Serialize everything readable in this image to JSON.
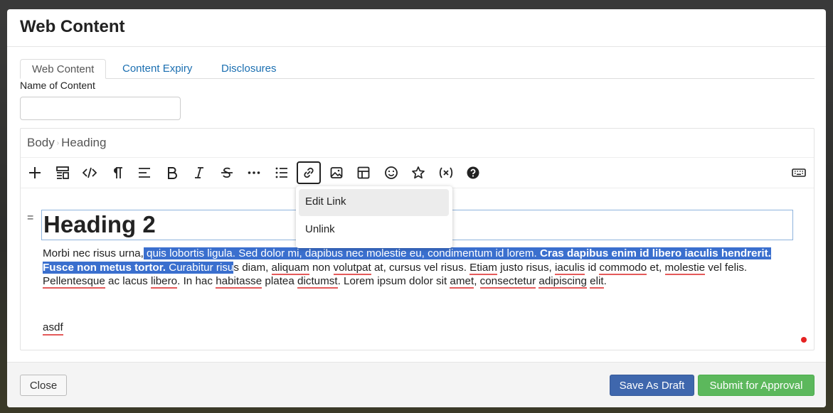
{
  "modal": {
    "title": "Web Content"
  },
  "tabs": [
    {
      "label": "Web Content",
      "active": true
    },
    {
      "label": "Content Expiry",
      "active": false
    },
    {
      "label": "Disclosures",
      "active": false
    }
  ],
  "name_field": {
    "label": "Name of Content",
    "value": "",
    "placeholder": ""
  },
  "editor": {
    "breadcrumb": [
      "Body",
      "Heading"
    ],
    "toolbar": [
      {
        "icon": "plus-icon"
      },
      {
        "icon": "blocks-icon"
      },
      {
        "icon": "code-icon"
      },
      {
        "icon": "paragraph-icon"
      },
      {
        "icon": "align-left-icon"
      },
      {
        "icon": "bold-icon"
      },
      {
        "icon": "italic-icon"
      },
      {
        "icon": "strikethrough-icon"
      },
      {
        "icon": "more-icon"
      },
      {
        "icon": "list-icon"
      },
      {
        "icon": "link-icon",
        "active": true
      },
      {
        "icon": "image-icon"
      },
      {
        "icon": "table-icon"
      },
      {
        "icon": "emoji-icon"
      },
      {
        "icon": "star-icon"
      },
      {
        "icon": "variable-icon"
      },
      {
        "icon": "help-icon"
      },
      {
        "icon": "keyboard-icon"
      }
    ],
    "block_handle": "=",
    "heading": "Heading 2",
    "paragraph": {
      "t1": "Morbi nec risus urna,",
      "s1": " quis lobortis ligula. Sed dolor mi, dapibus nec molestie eu, condimentum id lorem. ",
      "s2": "Cras dapibus enim id libero iaculis hendrerit. Fusce non metus tortor.",
      "s3": " Curabitur risu",
      "t2": "s diam, ",
      "w_aliquam": "aliquam",
      "t3": " non ",
      "w_volutpat": "volutpat",
      "t4": " at, cursus vel risus. ",
      "w_etiam": "Etiam",
      "t5": " justo risus, ",
      "w_iaculis": "iaculis",
      "t6": " id ",
      "w_commodo": "commodo",
      "t7": " et, ",
      "w_molestie": "molestie",
      "t8": " vel felis. ",
      "w_pellentesque": "Pellentesque",
      "t9": " ac lacus ",
      "w_libero": "libero",
      "t10": ". In hac ",
      "w_habitasse": "habitasse",
      "t11": " platea ",
      "w_dictumst": "dictumst",
      "t12": ". Lorem ipsum dolor sit ",
      "w_amet": "amet",
      "t13": ", ",
      "w_consectetur": "consectetur",
      "t14": " ",
      "w_adipiscing": "adipiscing",
      "t15": " ",
      "w_elit": "elit",
      "t16": "."
    },
    "second_paragraph": "asdf"
  },
  "link_popup": {
    "items": [
      {
        "label": "Edit Link",
        "highlighted": true
      },
      {
        "label": "Unlink",
        "highlighted": false
      }
    ]
  },
  "footer": {
    "close_label": "Close",
    "draft_label": "Save As Draft",
    "submit_label": "Submit for Approval"
  },
  "colors": {
    "tab_link": "#1b6fb1",
    "selection": "#3a6fce",
    "draft_button": "#3f67ad",
    "submit_button": "#5cb85c",
    "spellcheck": "#e45a5a",
    "status_dot": "#e52222"
  }
}
